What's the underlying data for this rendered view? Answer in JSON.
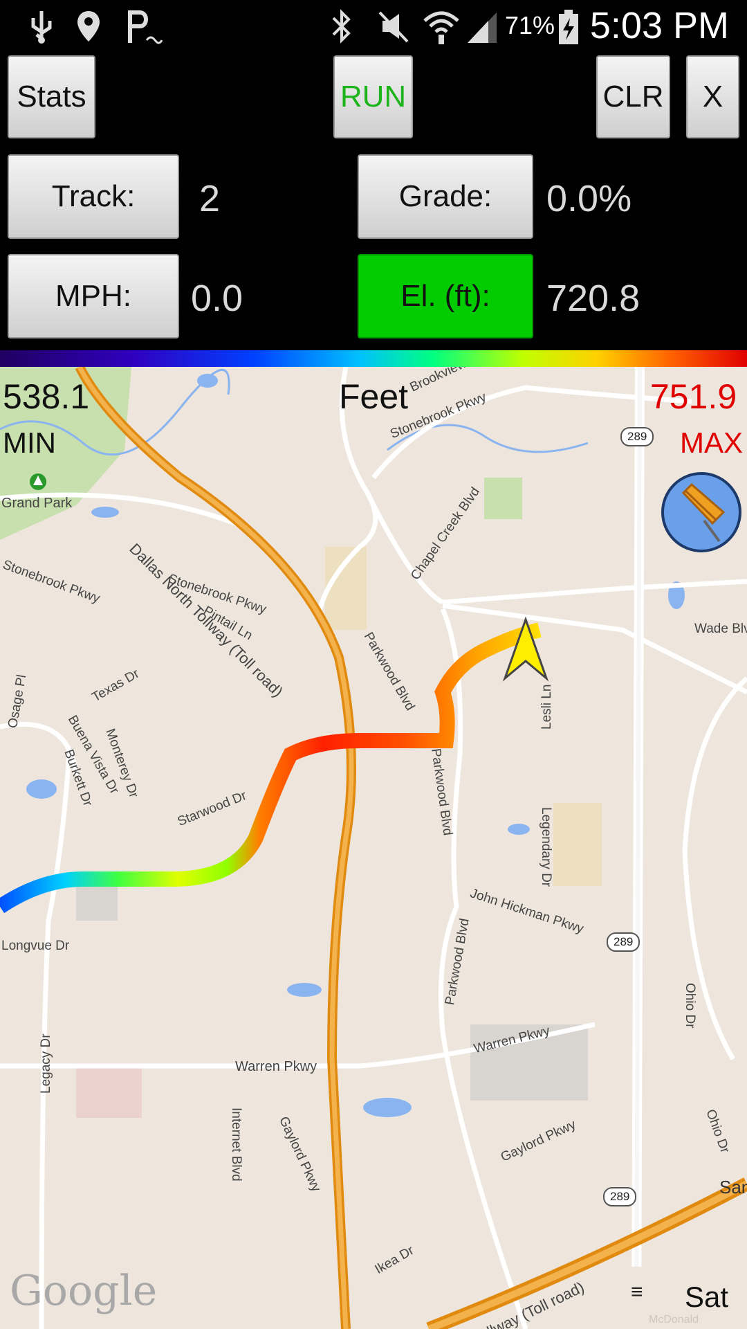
{
  "status_bar": {
    "icons": [
      "usb-icon",
      "location-pin-icon",
      "parking-icon",
      "bluetooth-icon",
      "mute-icon",
      "wifi-icon",
      "signal-icon",
      "battery-charging-icon"
    ],
    "battery": "71%",
    "time": "5:03 PM"
  },
  "toolbar": {
    "stats": "Stats",
    "run": "RUN",
    "clr": "CLR",
    "close": "X",
    "run_color": "#1db31d"
  },
  "metrics": {
    "track_label": "Track:",
    "track_value": "2",
    "grade_label": "Grade:",
    "grade_value": "0.0%",
    "mph_label": "MPH:",
    "mph_value": "0.0",
    "elev_label": "El. (ft):",
    "elev_value": "720.8",
    "elev_active_color": "#00cc00"
  },
  "map": {
    "min_value": "538.1",
    "min_label": "MIN",
    "unit_label": "Feet",
    "max_value": "751.9",
    "max_label": "MAX",
    "max_color": "#e00000",
    "google": "Google",
    "menu_icon": "≡",
    "sat": "Sat",
    "watermark": "McDonald",
    "streets": [
      "Grand Park",
      "Stonebrook Pkwy",
      "Stonebrook Pkwy",
      "Dallas North Tollway (Toll road)",
      "Parkwood Blvd",
      "Chapel Creek Blvd",
      "Pintail Ln",
      "Texas Dr",
      "Buena Vista Dr",
      "Burkett Dr",
      "Monterey Dr",
      "Osage Pl",
      "Starwood Dr",
      "Parkwood Blvd",
      "Lesli Ln",
      "Wade Blvd",
      "Legendary Dr",
      "John Hickman Pkwy",
      "Longvue Dr",
      "Warren Pkwy",
      "Warren Pkwy",
      "Internet Blvd",
      "Gaylord Pkwy",
      "Gaylord Pkwy",
      "Parkwood Blvd",
      "Ohio Dr",
      "Ohio Dr",
      "Legacy Dr",
      "Ikea Dr",
      "Tollway (Toll road)",
      "Brookview",
      "Stonebrook Pkwy",
      "289",
      "289",
      "289",
      "Sam"
    ]
  }
}
